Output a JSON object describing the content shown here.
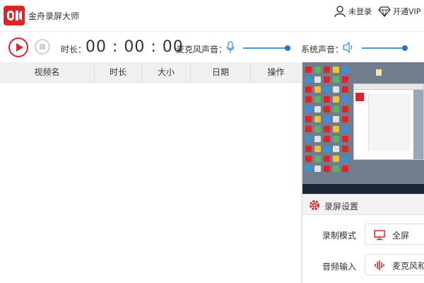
{
  "app": {
    "title": "金舟录屏大师",
    "logo_text": "OI"
  },
  "header": {
    "login_label": "未登录",
    "vip_label": "开通VIP"
  },
  "controls": {
    "duration_label": "时长：",
    "duration_value": "00 : 00 : 00",
    "mic_label": "麦克风声音：",
    "mic_volume": 1.0,
    "system_label": "系统声音：",
    "system_volume": 1.0
  },
  "table": {
    "columns": [
      "视频名",
      "时长",
      "大小",
      "日期",
      "操作"
    ],
    "rows": []
  },
  "settings": {
    "title": "录屏设置",
    "record_mode_label": "录制模式",
    "record_mode_value": "全屏",
    "audio_input_label": "音频输入",
    "audio_input_value": "麦克风和"
  },
  "colors": {
    "brand": "#d8262b",
    "accent": "#2a73c8"
  },
  "icons": {
    "user": "user-icon",
    "vip": "diamond-icon",
    "mic": "microphone-icon",
    "speaker": "speaker-icon",
    "gear": "gear-icon",
    "monitor": "monitor-icon",
    "audio": "sound-wave-icon"
  }
}
